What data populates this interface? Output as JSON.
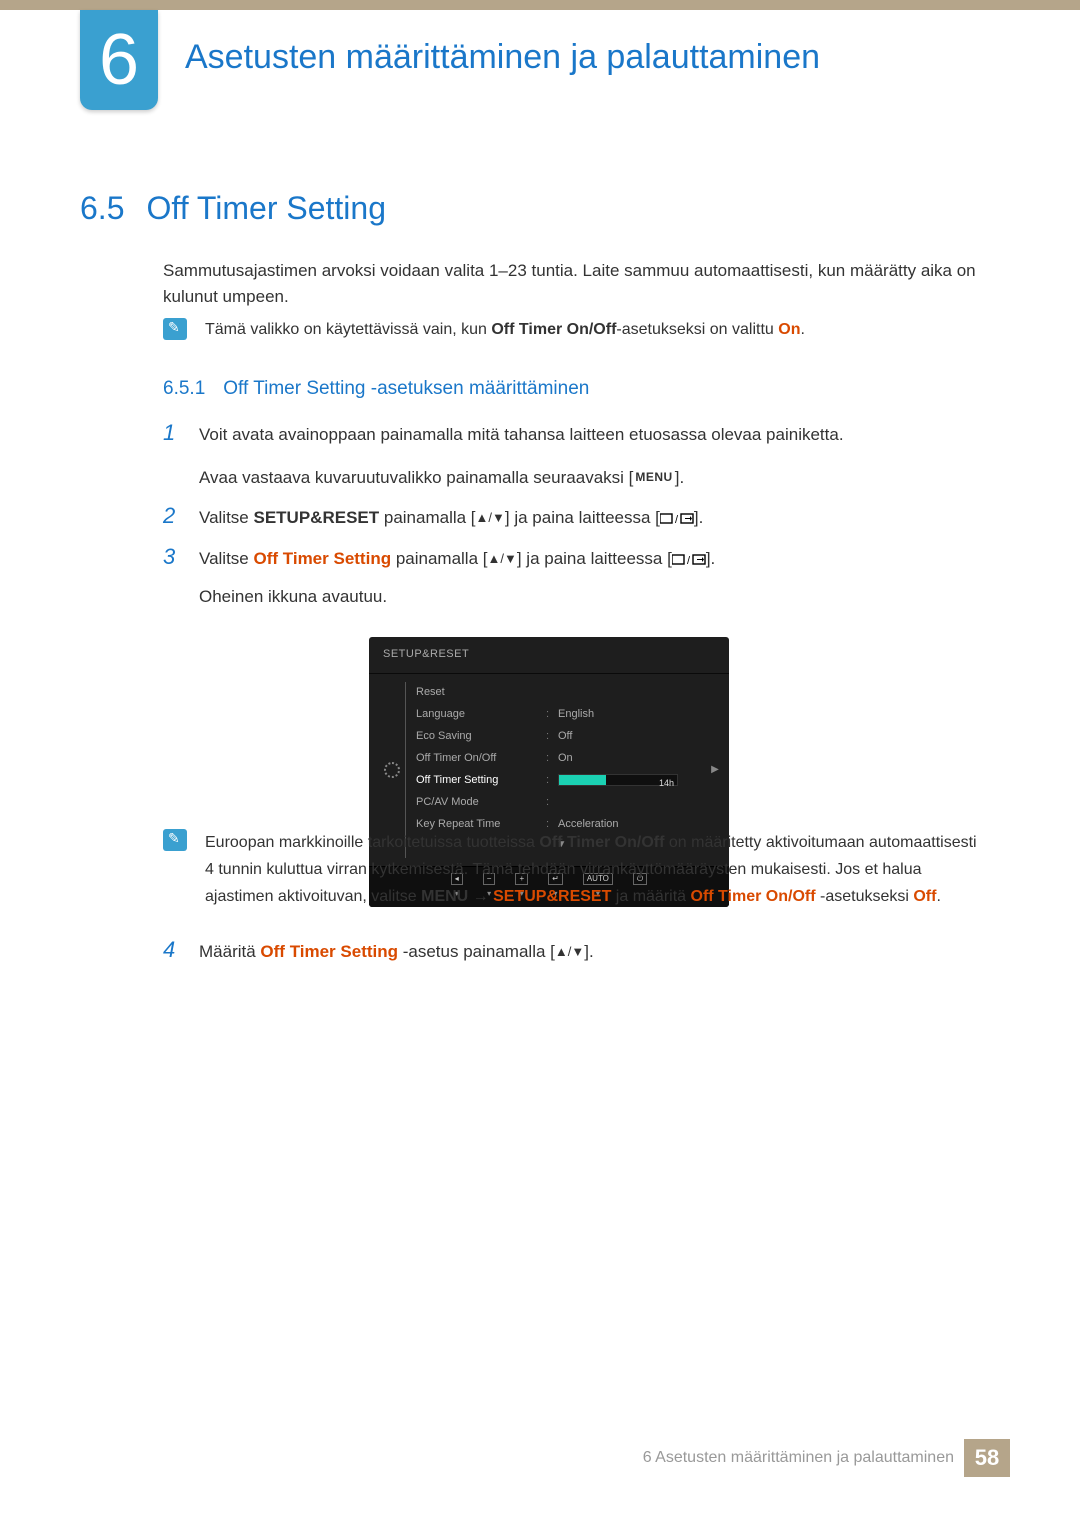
{
  "chapter": {
    "number": "6",
    "title": "Asetusten määrittäminen ja palauttaminen"
  },
  "section": {
    "number": "6.5",
    "title": "Off Timer Setting"
  },
  "intro": "Sammutusajastimen arvoksi voidaan valita 1–23 tuntia. Laite sammuu automaattisesti, kun määrätty aika on kulunut umpeen.",
  "note1": {
    "pre": "Tämä valikko on käytettävissä vain, kun ",
    "bold1": "Off Timer On/Off",
    "mid": "-asetukseksi on valittu ",
    "bold2": "On",
    "post": "."
  },
  "subsection": {
    "number": "6.5.1",
    "title": "Off Timer Setting -asetuksen määrittäminen"
  },
  "steps": {
    "s1": {
      "p1": "Voit avata avainoppaan painamalla mitä tahansa laitteen etuosassa olevaa painiketta.",
      "p2_pre": "Avaa vastaava kuvaruutuvalikko painamalla seuraavaksi [",
      "p2_menu": "MENU",
      "p2_post": "]."
    },
    "s2": {
      "pre": "Valitse ",
      "b1": "SETUP&RESET",
      "mid1": " painamalla [",
      "mid2": "] ja paina laitteessa [",
      "post": "]."
    },
    "s3": {
      "pre": "Valitse ",
      "b2": "Off Timer Setting",
      "mid1": " painamalla [",
      "mid2": "] ja paina laitteessa [",
      "post": "].",
      "p2": "Oheinen ikkuna avautuu."
    },
    "s4": {
      "pre": "Määritä ",
      "b2": "Off Timer Setting",
      "mid": " -asetus painamalla [",
      "post": "]."
    }
  },
  "osd": {
    "title": "SETUP&RESET",
    "rows": {
      "reset": {
        "label": "Reset",
        "val": ""
      },
      "language": {
        "label": "Language",
        "val": "English"
      },
      "eco": {
        "label": "Eco Saving",
        "val": "Off"
      },
      "onoff": {
        "label": "Off Timer On/Off",
        "val": "On"
      },
      "setting": {
        "label": "Off Timer Setting",
        "slider_text": "14h"
      },
      "pcav": {
        "label": "PC/AV Mode",
        "val": ""
      },
      "keyrep": {
        "label": "Key Repeat Time",
        "val": "Acceleration"
      }
    },
    "auto": "AUTO"
  },
  "note2": {
    "t1": "Euroopan markkinoille tarkoitetuissa tuotteissa ",
    "b1": "Off Timer On/Off",
    "t2": " on määritetty aktivoitumaan automaattisesti 4 tunnin kuluttua virran kytkemisestä. Tämä tehdään virrankäyttömääräysten mukaisesti. Jos et halua ajastimen aktivoituvan, valitse ",
    "b2": "MENU",
    "arrow": " → ",
    "b3": "SETUP&RESET",
    "t3": " ja määritä ",
    "b4": "Off Timer On/Off",
    "t4": " -asetukseksi ",
    "b5": "Off",
    "t5": "."
  },
  "footer": {
    "text": "6 Asetusten määrittäminen ja palauttaminen",
    "page": "58"
  }
}
